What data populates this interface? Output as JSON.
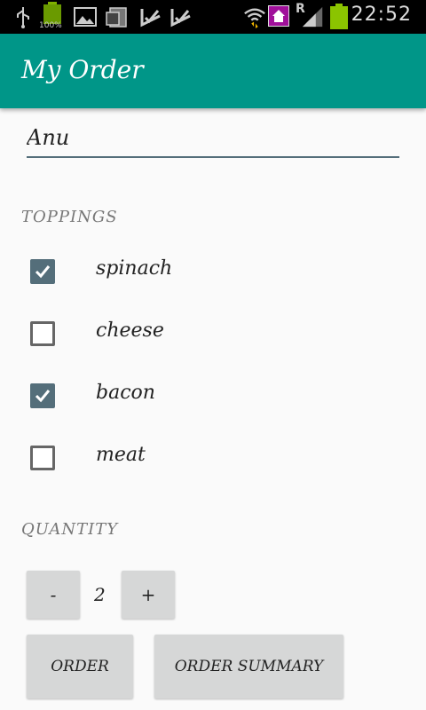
{
  "status_bar": {
    "time": "22:52",
    "icons": [
      "usb-icon",
      "battery-full-icon",
      "image-icon",
      "sd-card-icon",
      "check-icon",
      "check-icon",
      "wifi-icon",
      "home-icon",
      "signal-icon",
      "battery-icon"
    ],
    "battery_badge": "100%",
    "roaming": "R"
  },
  "app_bar": {
    "title": "My Order",
    "color": "#009688"
  },
  "form": {
    "name_value": "Anu",
    "toppings_header": "TOPPINGS",
    "toppings": [
      {
        "label": "spinach",
        "checked": true
      },
      {
        "label": "cheese",
        "checked": false
      },
      {
        "label": "bacon",
        "checked": true
      },
      {
        "label": "meat",
        "checked": false
      }
    ],
    "quantity_header": "QUANTITY",
    "decrement_label": "-",
    "quantity": "2",
    "increment_label": "+",
    "order_label": "ORDER",
    "summary_label": "ORDER SUMMARY"
  },
  "colors": {
    "accent": "#546e7a",
    "button": "#d6d7d7"
  }
}
